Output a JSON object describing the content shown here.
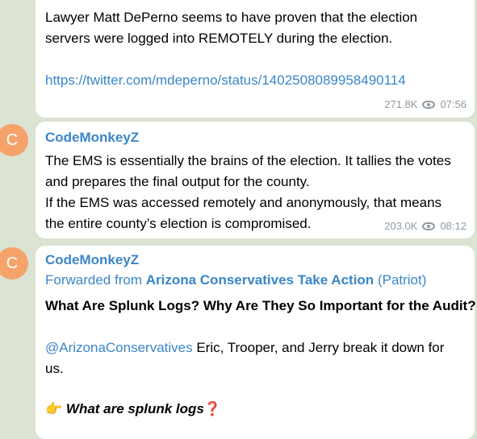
{
  "messages": [
    {
      "lines": [
        "Lawyer Matt DePerno seems to have proven that the election",
        "servers were logged into REMOTELY during the election."
      ],
      "link": "https://twitter.com/mdeperno/status/1402508089958490114",
      "views": "271.8K",
      "time": "07:56"
    },
    {
      "avatar_letter": "C",
      "author": "CodeMonkeyZ",
      "lines": [
        "The EMS is essentially the brains of the election. It tallies the votes",
        "and prepares the final output for the county.",
        "If the EMS was accessed remotely and anonymously, that means",
        "the entire county’s election is compromised."
      ],
      "views": "203.0K",
      "time": "08:12"
    },
    {
      "avatar_letter": "C",
      "author": "CodeMonkeyZ",
      "forwarded_prefix": "Forwarded from",
      "forwarded_source": "Arizona Conservatives Take Action",
      "forwarded_suffix": "(Patriot)",
      "headline": "What Are Splunk Logs? Why Are They So Important for the Audit?",
      "mention": "@ArizonaConservatives",
      "body_line1": " Eric, Trooper, and Jerry break it down for",
      "body_line2": "us.",
      "emoji": "👉",
      "subheading": "What are splunk logs",
      "subheading_mark": "❓"
    }
  ],
  "colors": {
    "background": "#dbe3d3",
    "bubble": "#ffffff",
    "accent": "#3a86c8",
    "avatar": "#f5a36b",
    "meta": "#8e9aa3"
  },
  "icons": {
    "views": "eye-icon"
  }
}
